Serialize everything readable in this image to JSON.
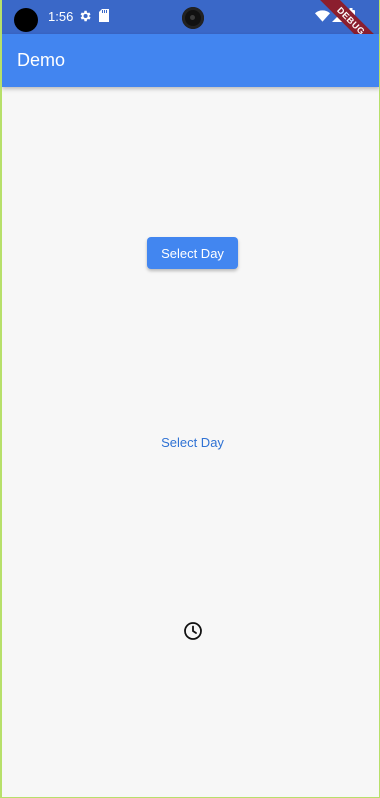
{
  "status_bar": {
    "time": "1:56",
    "icons": [
      "settings-gear-icon",
      "sd-card-icon",
      "wifi-icon",
      "signal-icon",
      "battery-icon"
    ],
    "debug_banner": "DEBUG"
  },
  "app_bar": {
    "title": "Demo",
    "color": "#4285f0"
  },
  "main": {
    "elevated_button_label": "Select Day",
    "text_button_label": "Select Day",
    "icon_button": "clock-icon"
  },
  "colors": {
    "status_bar": "#3a68c8",
    "primary": "#4285f0",
    "background": "#f7f7f7",
    "debug_ribbon": "#8b1e2e"
  }
}
